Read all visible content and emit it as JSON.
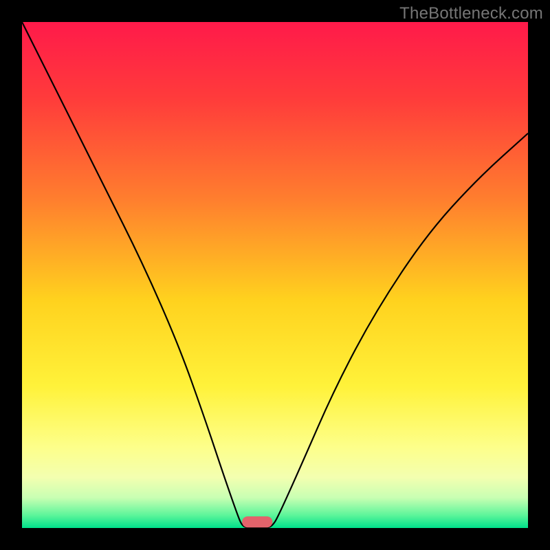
{
  "watermark": "TheBottleneck.com",
  "chart_data": {
    "type": "line",
    "title": "",
    "xlabel": "",
    "ylabel": "",
    "xlim": [
      0,
      100
    ],
    "ylim": [
      0,
      100
    ],
    "grid": false,
    "legend": false,
    "gradient_stops": [
      {
        "offset": 0.0,
        "color": "#ff1a4a"
      },
      {
        "offset": 0.15,
        "color": "#ff3b3b"
      },
      {
        "offset": 0.35,
        "color": "#ff7e2e"
      },
      {
        "offset": 0.55,
        "color": "#ffd21e"
      },
      {
        "offset": 0.72,
        "color": "#fff23a"
      },
      {
        "offset": 0.84,
        "color": "#fdff8a"
      },
      {
        "offset": 0.9,
        "color": "#f3ffb0"
      },
      {
        "offset": 0.94,
        "color": "#c9ffb3"
      },
      {
        "offset": 0.975,
        "color": "#5cf59a"
      },
      {
        "offset": 1.0,
        "color": "#00e08a"
      }
    ],
    "curve": {
      "comment": "V-shaped bottleneck curve; points are (x%, y%)",
      "points": [
        [
          0,
          100
        ],
        [
          8,
          84
        ],
        [
          16,
          68
        ],
        [
          24,
          52
        ],
        [
          31,
          36
        ],
        [
          36,
          22
        ],
        [
          40,
          10
        ],
        [
          42.8,
          2
        ],
        [
          43.5,
          0.5
        ],
        [
          44.5,
          0
        ],
        [
          48.5,
          0
        ],
        [
          49.5,
          0.5
        ],
        [
          50.5,
          2
        ],
        [
          55,
          12
        ],
        [
          62,
          28
        ],
        [
          70,
          43
        ],
        [
          80,
          58
        ],
        [
          90,
          69
        ],
        [
          100,
          78
        ]
      ]
    },
    "marker": {
      "x": 46.5,
      "y": 1.2,
      "width": 6,
      "height": 2.2,
      "color": "#e2636b"
    }
  }
}
